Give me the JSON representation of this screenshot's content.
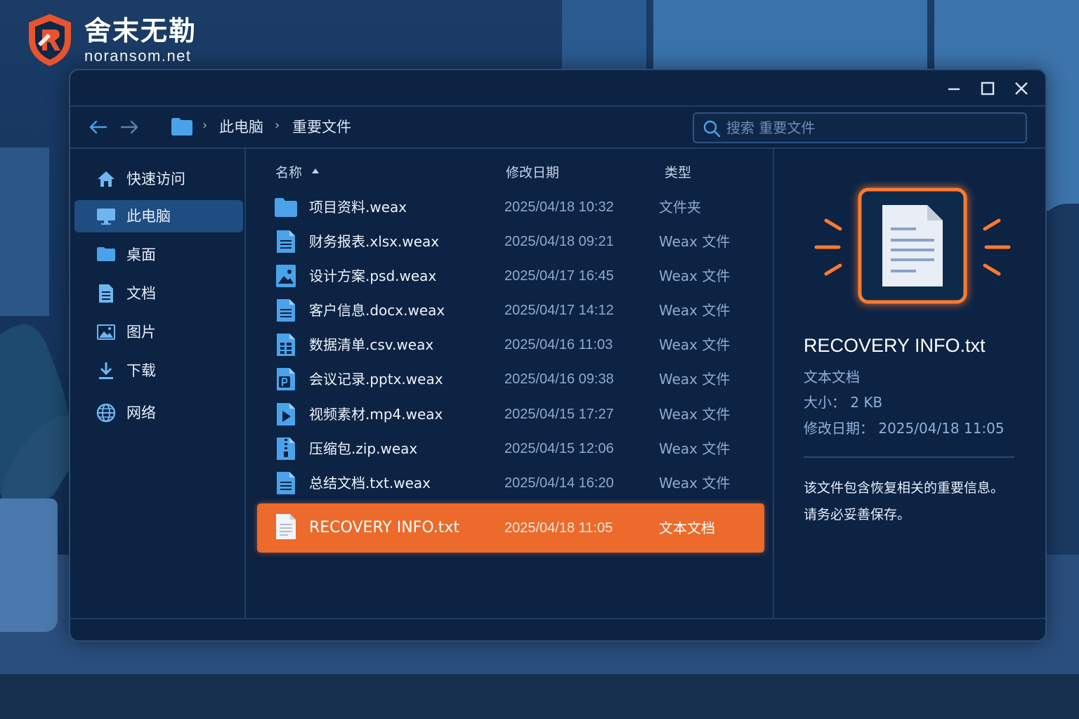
{
  "brand": {
    "name": "舍末无勒",
    "url": "noransom.net",
    "accent": "#e8542e"
  },
  "toolbar": {
    "breadcrumb": [
      "此电脑",
      "重要文件"
    ],
    "search_placeholder": "搜索 重要文件"
  },
  "sidebar": {
    "items": [
      {
        "label": "快速访问",
        "icon": "home-icon"
      },
      {
        "label": "此电脑",
        "icon": "monitor-icon",
        "active": true
      },
      {
        "label": "桌面",
        "icon": "desktop-icon"
      },
      {
        "label": "文档",
        "icon": "document-icon"
      },
      {
        "label": "图片",
        "icon": "image-icon"
      },
      {
        "label": "下载",
        "icon": "download-icon"
      },
      {
        "label": "网络",
        "icon": "globe-icon"
      }
    ]
  },
  "filelist": {
    "columns": {
      "name": "名称",
      "date": "修改日期",
      "type": "类型"
    },
    "rows": [
      {
        "name": "项目资料.weax",
        "date": "2025/04/18 10:32",
        "type": "文件夹",
        "icon": "folder-icon"
      },
      {
        "name": "财务报表.xlsx.weax",
        "date": "2025/04/18 09:21",
        "type": "Weax 文件",
        "icon": "file-text-icon"
      },
      {
        "name": "设计方案.psd.weax",
        "date": "2025/04/17 16:45",
        "type": "Weax 文件",
        "icon": "file-image-icon"
      },
      {
        "name": "客户信息.docx.weax",
        "date": "2025/04/17 14:12",
        "type": "Weax 文件",
        "icon": "file-text-icon"
      },
      {
        "name": "数据清单.csv.weax",
        "date": "2025/04/16 11:03",
        "type": "Weax 文件",
        "icon": "file-table-icon"
      },
      {
        "name": "会议记录.pptx.weax",
        "date": "2025/04/16 09:38",
        "type": "Weax 文件",
        "icon": "file-presentation-icon"
      },
      {
        "name": "视频素材.mp4.weax",
        "date": "2025/04/15 17:27",
        "type": "Weax 文件",
        "icon": "file-video-icon"
      },
      {
        "name": "压缩包.zip.weax",
        "date": "2025/04/15 12:06",
        "type": "Weax 文件",
        "icon": "file-zip-icon"
      },
      {
        "name": "总结文档.txt.weax",
        "date": "2025/04/14 16:20",
        "type": "Weax 文件",
        "icon": "file-text-icon"
      },
      {
        "name": "RECOVERY INFO.txt",
        "date": "2025/04/18 11:05",
        "type": "文本文档",
        "icon": "file-text-icon",
        "selected": true
      }
    ]
  },
  "details": {
    "title": "RECOVERY INFO.txt",
    "kind": "文本文档",
    "size": "大小： 2 KB",
    "modified": "修改日期： 2025/04/18 11:05",
    "description": [
      "该文件包含恢复相关的重要信息。",
      "请务必妥善保存。"
    ]
  },
  "colors": {
    "window_bg": "#0c2343",
    "selected_row": "#ec6a2b",
    "accent_blue": "#4aa3ea"
  }
}
